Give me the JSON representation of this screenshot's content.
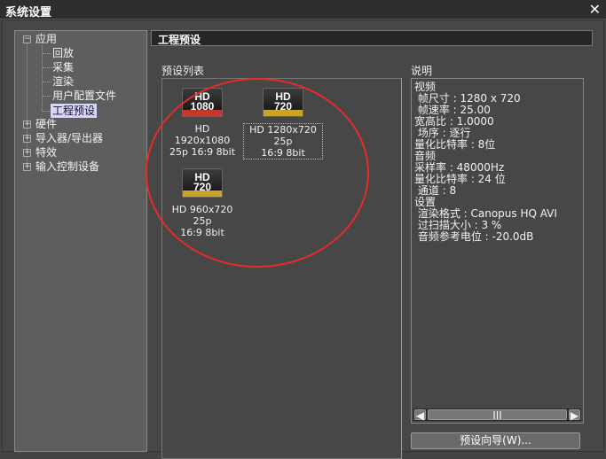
{
  "window": {
    "title": "系统设置",
    "close": "✕"
  },
  "tree": {
    "app": "应用",
    "app_box": "−",
    "children": [
      "回放",
      "采集",
      "渲染",
      "用户配置文件",
      "工程预设"
    ],
    "others": [
      "硬件",
      "导入器/导出器",
      "特效",
      "输入控制设备"
    ],
    "plus": "+"
  },
  "header": "工程预设",
  "preset_list": {
    "label": "预设列表",
    "items": [
      {
        "badge_top": "HD",
        "badge_bottom": "1080",
        "color": "#c0392b",
        "line1": "HD 1920x1080",
        "line2": "25p 16:9 8bit"
      },
      {
        "badge_top": "HD",
        "badge_bottom": "720",
        "color": "#c9a227",
        "line1": "HD 1280x720 25p",
        "line2": "16:9 8bit"
      },
      {
        "badge_top": "HD",
        "badge_bottom": "720",
        "color": "#c9a227",
        "line1": "HD 960x720 25p",
        "line2": "16:9 8bit"
      }
    ]
  },
  "description": {
    "label": "说明",
    "lines": [
      "视频",
      " 帧尺寸 : 1280 x 720",
      " 帧速率 : 25.00",
      "宽高比 : 1.0000",
      " 场序 : 逐行",
      "量化比特率 : 8位",
      "音频",
      "采样率 : 48000Hz",
      "量化比特率 : 24 位",
      " 通道 : 8",
      "设置",
      " 渲染格式 : Canopus HQ AVI",
      " 过扫描大小 : 3 %",
      " 音频参考电位 : -20.0dB"
    ],
    "scroll_grip": "III",
    "left_arrow": "◀",
    "right_arrow": "▶"
  },
  "wizard_button": "预设向导(W)..."
}
